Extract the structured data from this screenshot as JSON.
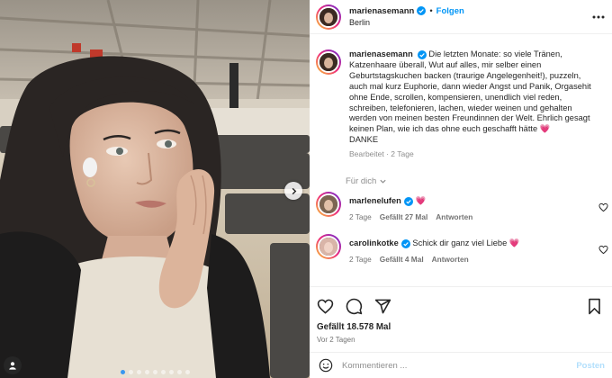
{
  "post": {
    "author": "marienasemann",
    "follow_label": "Folgen",
    "location": "Berlin",
    "caption": "Die letzten Monate: so viele Tränen, Katzenhaare überall, Wut auf alles, mir selber einen Geburtstagskuchen backen (traurige Angelegenheit!), puzzeln, auch mal kurz Euphorie, dann wieder Angst und Panik, Orgasehit ohne Ende, scrollen, kompensieren, unendlich viel reden, schreiben, telefonieren, lachen, wieder weinen und gehalten werden von meinen besten Freundinnen der Welt. Ehrlich gesagt keinen Plan, wie ich das ohne euch geschafft hätte",
    "caption_emoji": "💗",
    "caption_last_line": "DANKE",
    "caption_meta": "Bearbeitet · 2 Tage",
    "for_you_label": "Für dich",
    "comments": [
      {
        "username": "marlenelufen",
        "text": "",
        "emoji": "💗",
        "age": "2 Tage",
        "likes": "Gefällt 27 Mal",
        "reply": "Antworten"
      },
      {
        "username": "carolinkotke",
        "text": "Schick dir ganz viel Liebe",
        "emoji": "💗",
        "age": "2 Tage",
        "likes": "Gefällt 4 Mal",
        "reply": "Antworten"
      }
    ],
    "likes_label": "Gefällt 18.578 Mal",
    "date_label": "Vor 2 Tagen",
    "comment_placeholder": "Kommentieren ...",
    "post_button": "Posten"
  },
  "carousel": {
    "slide_count": 9,
    "active_index": 0
  },
  "colors": {
    "follow": "#0095f6",
    "verified": "#0095f6",
    "heart": "#ff3040",
    "post_disabled": "#b2dffc"
  },
  "icons": [
    "verified-icon",
    "more-options-icon",
    "chevron-down-icon",
    "small-heart-icon",
    "heart-icon",
    "comment-icon",
    "share-icon",
    "bookmark-icon",
    "emoji-icon",
    "chevron-right-icon",
    "user-tag-icon"
  ]
}
